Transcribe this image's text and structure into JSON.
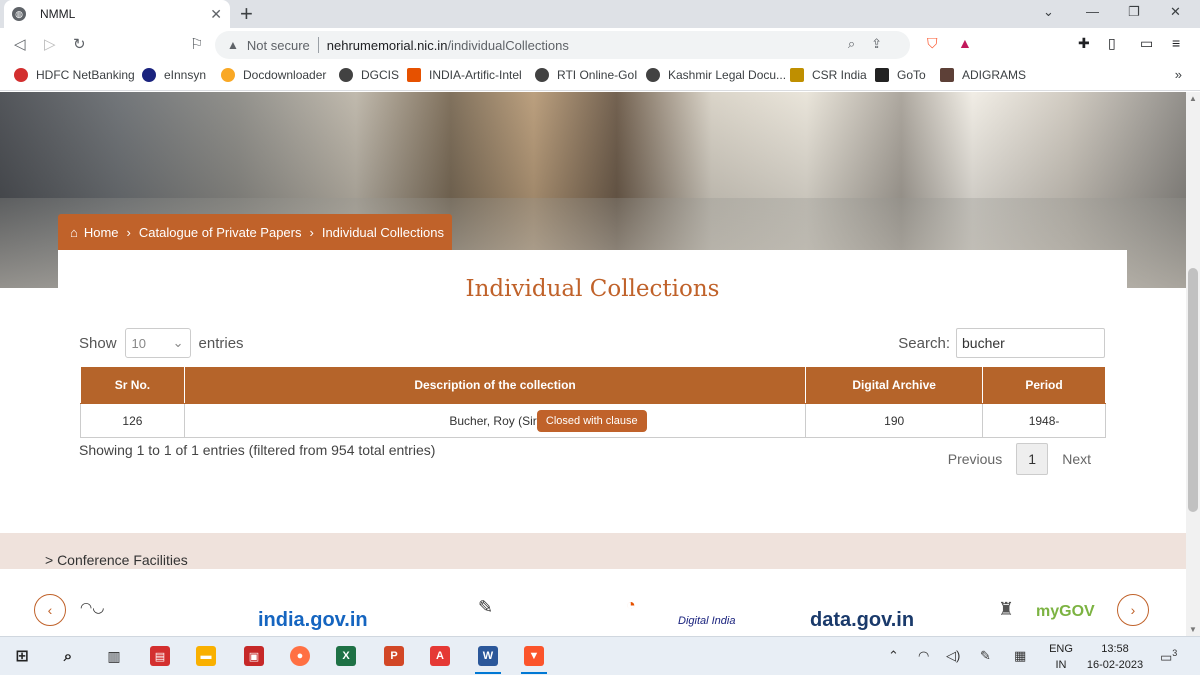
{
  "browser": {
    "tab_title": "NMML",
    "address_warning": "Not secure",
    "url_host": "nehrumemorial.nic.in",
    "url_path": "/individualCollections",
    "bookmarks": [
      {
        "label": "HDFC NetBanking",
        "color": "#d32f2f"
      },
      {
        "label": "eInnsyn",
        "color": "#1a237e"
      },
      {
        "label": "Docdownloader",
        "color": "#f9a825"
      },
      {
        "label": "DGCIS",
        "color": "#424242"
      },
      {
        "label": "INDIA-Artific-Intel",
        "color": "#e65100"
      },
      {
        "label": "RTI Online-GoI",
        "color": "#424242"
      },
      {
        "label": "Kashmir Legal Docu...",
        "color": "#424242"
      },
      {
        "label": "CSR India",
        "color": "#bf8f00"
      },
      {
        "label": "GoTo",
        "color": "#222222"
      },
      {
        "label": "ADIGRAMS",
        "color": "#5d4037"
      }
    ],
    "more_bookmarks": "»"
  },
  "breadcrumb": {
    "home": "Home",
    "level1": "Catalogue of Private Papers",
    "level2": "Individual Collections"
  },
  "page": {
    "title": "Individual Collections",
    "show_label": "Show",
    "entries_label": "entries",
    "entries_per_page": "10",
    "search_label": "Search:",
    "search_value": "bucher"
  },
  "table": {
    "headers": [
      "Sr No.",
      "Description of the collection",
      "Digital Archive",
      "Period"
    ],
    "rows": [
      {
        "sr_no": "126",
        "description": "Bucher, Roy (Sir)",
        "digital_archive": "190",
        "period": "1948-"
      }
    ],
    "tooltip": "Closed with clause"
  },
  "pagination": {
    "info": "Showing 1 to 1 of 1 entries (filtered from 954 total entries)",
    "previous": "Previous",
    "current_page": "1",
    "next": "Next"
  },
  "footer": {
    "link": "> Conference Facilities",
    "logos": [
      "india.gov.in",
      "Digital India",
      "data.gov.in",
      "myGOV"
    ]
  },
  "taskbar": {
    "lang_line1": "ENG",
    "lang_line2": "IN",
    "time": "13:58",
    "date": "16-02-2023",
    "notification_count": "3"
  },
  "colors": {
    "accent": "#c0622a",
    "table_header": "#b5642a",
    "footer_band": "#efe2dc"
  }
}
